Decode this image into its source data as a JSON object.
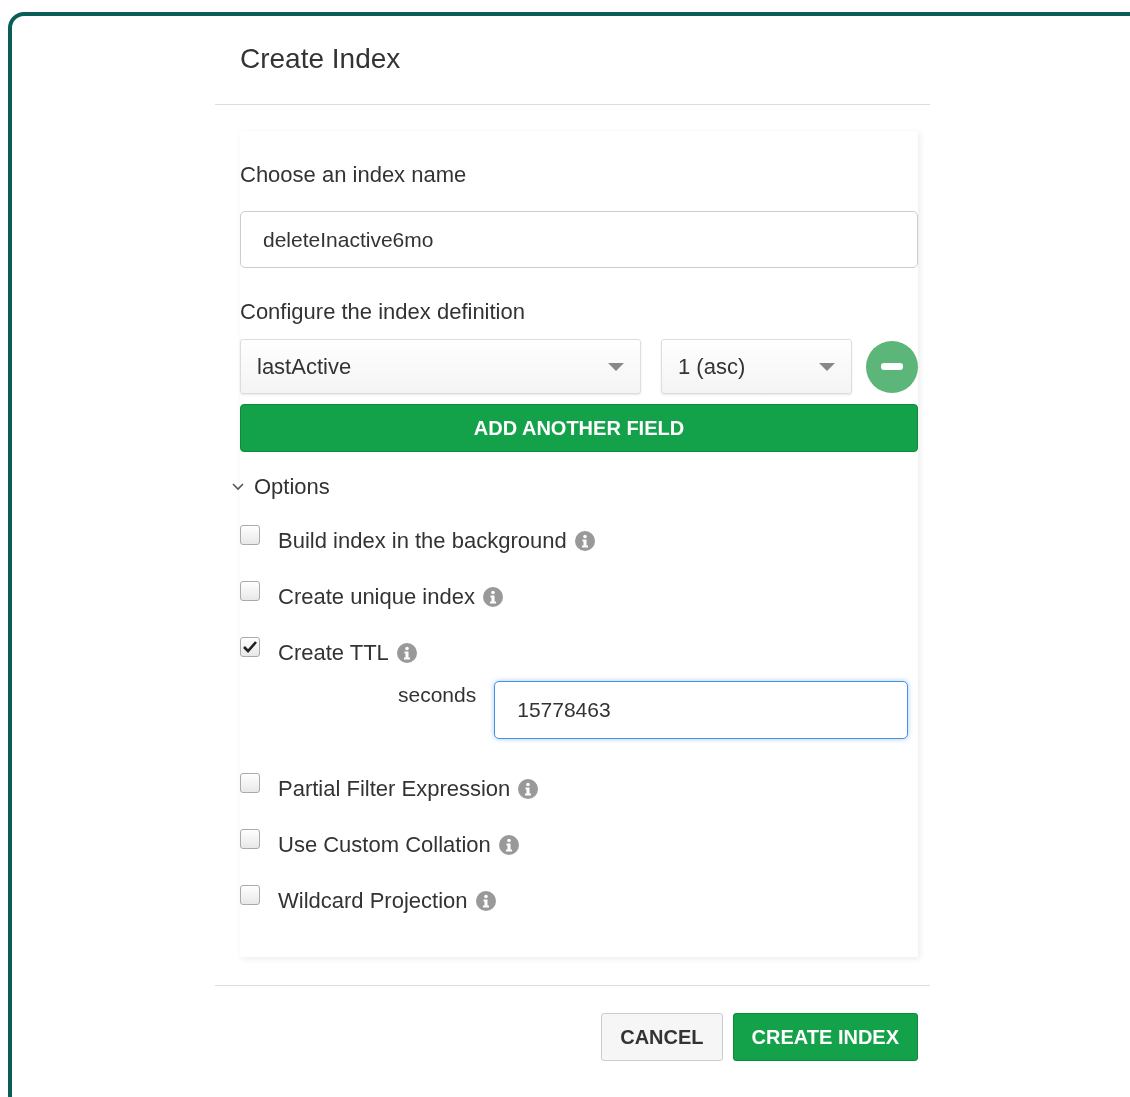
{
  "dialog": {
    "title": "Create Index"
  },
  "name_section": {
    "label": "Choose an index name",
    "value": "deleteInactive6mo"
  },
  "definition": {
    "label": "Configure the index definition",
    "fields": [
      {
        "field": "lastActive",
        "type": "1 (asc)"
      }
    ],
    "add_button": "ADD ANOTHER FIELD"
  },
  "options": {
    "label": "Options",
    "expanded": true,
    "items": [
      {
        "label": "Build index in the background",
        "checked": false
      },
      {
        "label": "Create unique index",
        "checked": false
      },
      {
        "label": "Create TTL",
        "checked": true,
        "sub_field": {
          "label": "seconds",
          "value": "15778463",
          "focused": true
        }
      },
      {
        "label": "Partial Filter Expression",
        "checked": false
      },
      {
        "label": "Use Custom Collation",
        "checked": false
      },
      {
        "label": "Wildcard Projection",
        "checked": false
      }
    ]
  },
  "buttons": [
    {
      "label": "CANCEL",
      "kind": "secondary"
    },
    {
      "label": "CREATE INDEX",
      "kind": "primary"
    }
  ]
}
